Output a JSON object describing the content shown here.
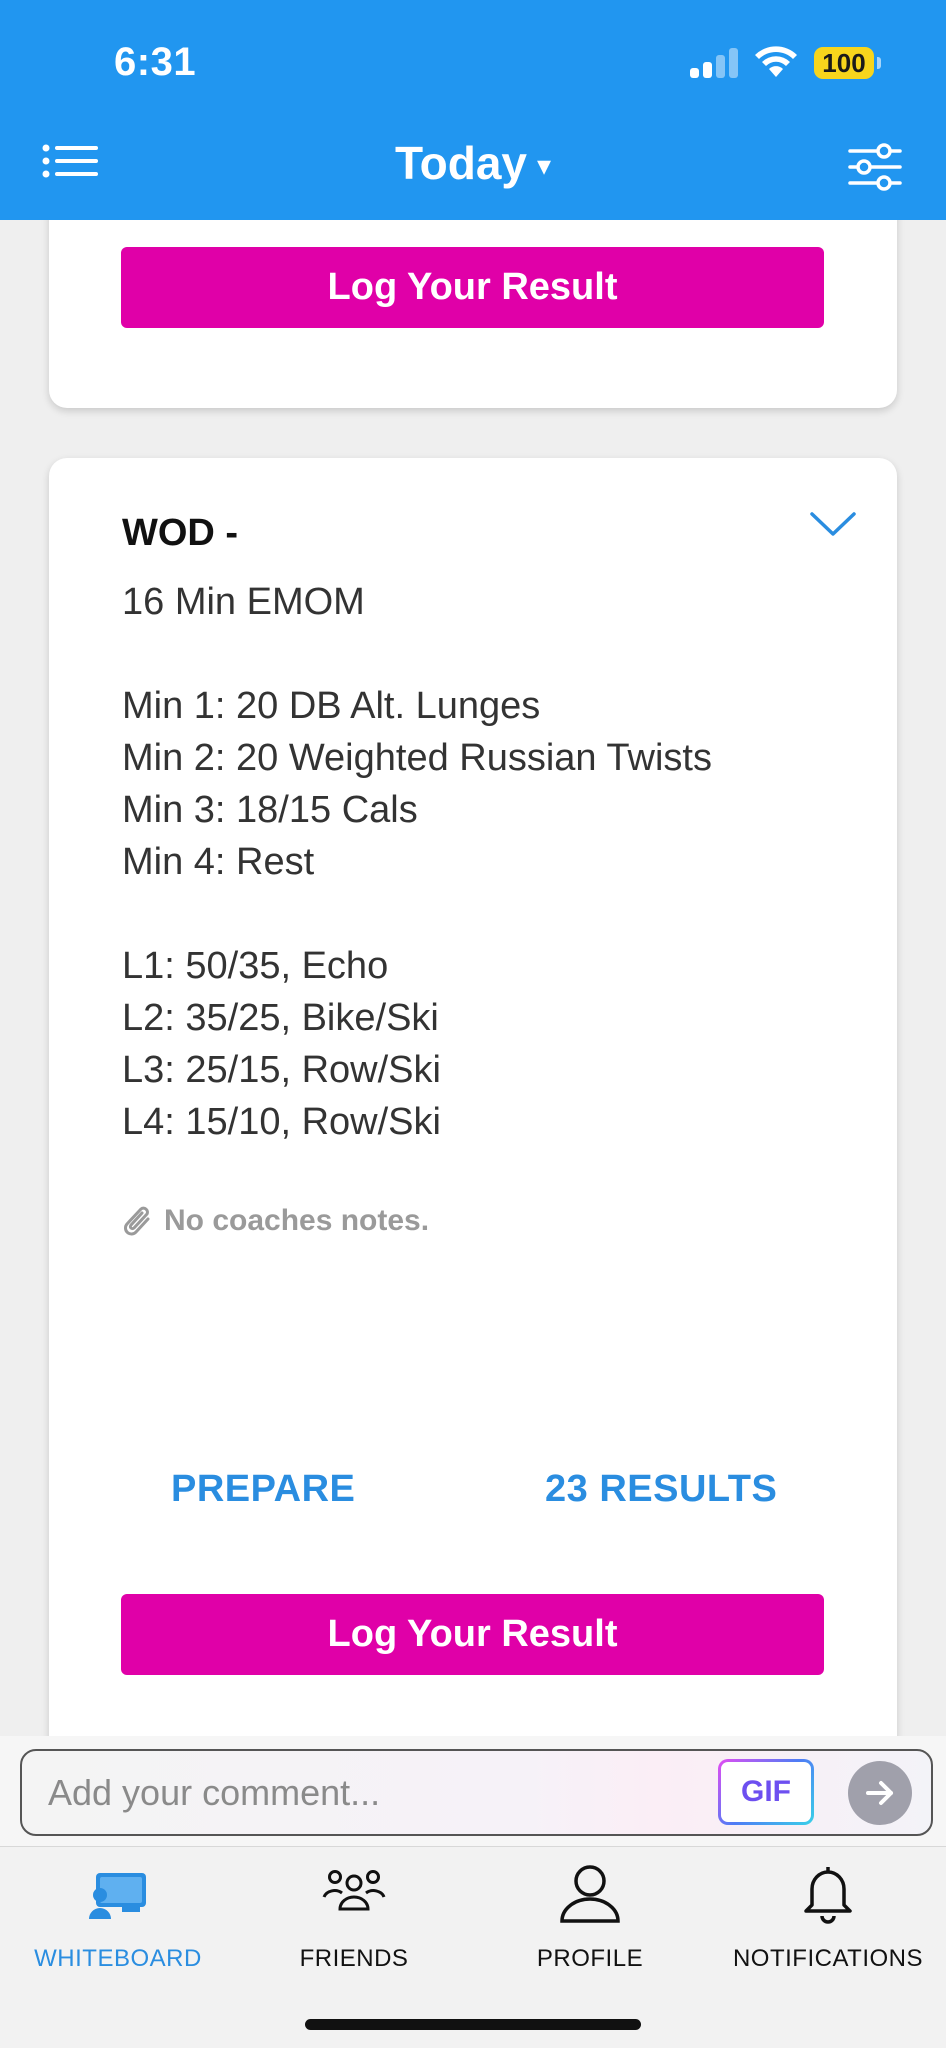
{
  "status_bar": {
    "time": "6:31",
    "battery": "100"
  },
  "header": {
    "title": "Today",
    "caret": "▾",
    "background_color": "#2196f0"
  },
  "cards": {
    "top": {
      "log_label": "Log Your Result"
    },
    "wod": {
      "title": "WOD -",
      "lines": [
        "16 Min EMOM",
        "",
        "Min 1: 20 DB Alt. Lunges",
        "Min 2: 20 Weighted Russian Twists",
        "Min 3: 18/15 Cals",
        "Min 4: Rest",
        "",
        "L1: 50/35, Echo",
        "L2: 35/25, Bike/Ski",
        "L3: 25/15, Row/Ski",
        "L4: 15/10, Row/Ski"
      ],
      "notes": "No coaches notes.",
      "prepare_label": "PREPARE",
      "results_label": "23 RESULTS",
      "log_label": "Log Your Result",
      "accent_color": "#e000a8",
      "link_color": "#2a8de0"
    }
  },
  "comment": {
    "placeholder": "Add your comment...",
    "gif_label": "GIF"
  },
  "nav": {
    "items": [
      {
        "label": "WHITEBOARD",
        "icon": "whiteboard-icon",
        "active": true
      },
      {
        "label": "FRIENDS",
        "icon": "friends-icon",
        "active": false
      },
      {
        "label": "PROFILE",
        "icon": "profile-icon",
        "active": false
      },
      {
        "label": "NOTIFICATIONS",
        "icon": "bell-icon",
        "active": false
      }
    ]
  }
}
